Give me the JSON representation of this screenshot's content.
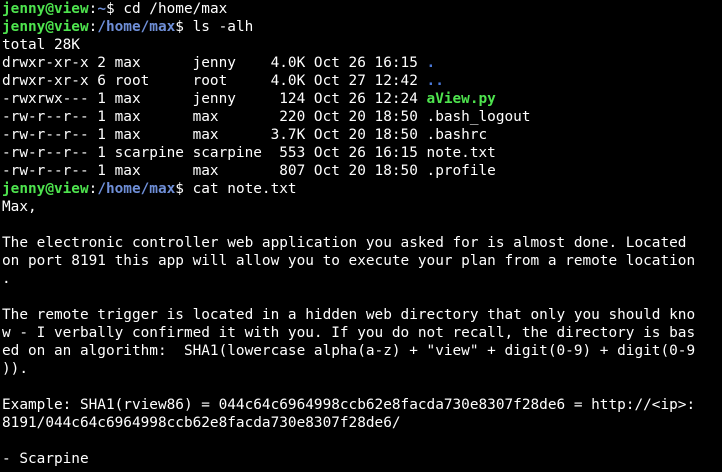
{
  "colors": {
    "background": "#000000",
    "foreground": "#ffffff",
    "prompt_user": "#4ee44e",
    "prompt_path": "#6f8fd8",
    "dir": "#4a78d8",
    "executable": "#4ee44e"
  },
  "prompts": [
    {
      "user": "jenny@view",
      "sep": ":",
      "path": "~",
      "sym": "$ ",
      "cmd": "cd /home/max"
    },
    {
      "user": "jenny@view",
      "sep": ":",
      "path": "/home/max",
      "sym": "$ ",
      "cmd": "ls -alh"
    },
    {
      "user": "jenny@view",
      "sep": ":",
      "path": "/home/max",
      "sym": "$ ",
      "cmd": "cat note.txt"
    }
  ],
  "ls": {
    "total": "total 28K",
    "entries": [
      {
        "meta": "drwxr-xr-x 2 max      jenny    4.0K Oct 26 16:15 ",
        "name": "."
      },
      {
        "meta": "drwxr-xr-x 6 root     root     4.0K Oct 27 12:42 ",
        "name": ".."
      },
      {
        "meta": "-rwxrwx--- 1 max      jenny     124 Oct 26 12:24 ",
        "name": "aView.py"
      },
      {
        "meta": "-rw-r--r-- 1 max      max       220 Oct 20 18:50 ",
        "name": ".bash_logout"
      },
      {
        "meta": "-rw-r--r-- 1 max      max      3.7K Oct 20 18:50 ",
        "name": ".bashrc"
      },
      {
        "meta": "-rw-r--r-- 1 scarpine scarpine  553 Oct 26 16:15 ",
        "name": "note.txt"
      },
      {
        "meta": "-rw-r--r-- 1 max      max       807 Oct 20 18:50 ",
        "name": ".profile"
      }
    ]
  },
  "note": [
    "Max,",
    "",
    "The electronic controller web application you asked for is almost done. Located",
    "on port 8191 this app will allow you to execute your plan from a remote location",
    ".",
    "",
    "The remote trigger is located in a hidden web directory that only you should kno",
    "w - I verbally confirmed it with you. If you do not recall, the directory is bas",
    "ed on an algorithm:  SHA1(lowercase alpha(a-z) + \"view\" + digit(0-9) + digit(0-9",
    ")).",
    "",
    "Example: SHA1(rview86) = 044c64c6964998ccb62e8facda730e8307f28de6 = http://<ip>:",
    "8191/044c64c6964998ccb62e8facda730e8307f28de6/",
    "",
    "- Scarpine"
  ]
}
